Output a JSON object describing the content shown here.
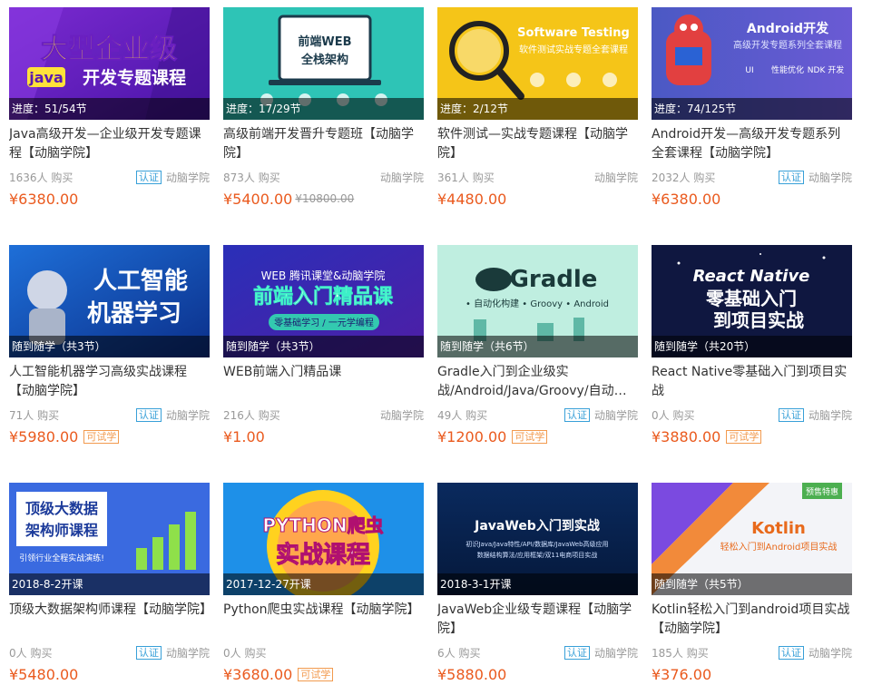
{
  "colors": {
    "price": "#ea5a1e",
    "cert": "#38a0d8",
    "trial": "#f29a4e"
  },
  "courses": [
    {
      "status": "进度：51/54节",
      "title": "Java高级开发—企业级开发专题课程【动脑学院】",
      "buyers": "1636人 购买",
      "cert": "认证",
      "org": "动脑学院",
      "price": "¥6380.00",
      "banner": {
        "line1": "大型企业级",
        "tag": "java",
        "line2": "开发专题课程"
      }
    },
    {
      "status": "进度：17/29节",
      "title": "高级前端开发晋升专题班【动脑学院】",
      "buyers": "873人 购买",
      "org": "动脑学院",
      "price": "¥5400.00",
      "old_price": "¥10800.00",
      "banner": {
        "line1": "前端WEB",
        "line2": "全栈架构"
      }
    },
    {
      "status": "进度：2/12节",
      "title": "软件测试—实战专题课程【动脑学院】",
      "buyers": "361人 购买",
      "org": "动脑学院",
      "price": "¥4480.00",
      "banner": {
        "line1": "Software Testing",
        "line2": "软件测试实战专题全套课程"
      }
    },
    {
      "status": "进度：74/125节",
      "title": "Android开发—高级开发专题系列全套课程【动脑学院】",
      "buyers": "2032人 购买",
      "cert": "认证",
      "org": "动脑学院",
      "price": "¥6380.00",
      "banner": {
        "line1": "Android开发",
        "line2": "高级开发专题系列全套课程",
        "tags": [
          "UI",
          "性能优化",
          "NDK 开发"
        ]
      }
    },
    {
      "status": "随到随学（共3节）",
      "title": "人工智能机器学习高级实战课程【动脑学院】",
      "buyers": "71人 购买",
      "cert": "认证",
      "org": "动脑学院",
      "price": "¥5980.00",
      "trial": "可试学",
      "banner": {
        "line1": "人工智能",
        "line2": "机器学习"
      }
    },
    {
      "status": "随到随学（共3节）",
      "title": "WEB前端入门精品课",
      "buyers": "216人 购买",
      "org": "动脑学院",
      "price": "¥1.00",
      "banner": {
        "line0": "WEB 腾讯课堂&动脑学院",
        "line1": "前端入门精品课",
        "line2": "零基础学习 / 一元学编程"
      }
    },
    {
      "status": "随到随学（共6节）",
      "title": "Gradle入门到企业级实战/Android/Java/Groovy/自动化构建",
      "buyers": "49人 购买",
      "cert": "认证",
      "org": "动脑学院",
      "price": "¥1200.00",
      "trial": "可试学",
      "banner": {
        "line1": "Gradle",
        "line2": "• 自动化构建   • Groovy   • Android"
      }
    },
    {
      "status": "随到随学（共20节）",
      "title": "React Native零基础入门到项目实战",
      "buyers": "0人 购买",
      "cert": "认证",
      "org": "动脑学院",
      "price": "¥3880.00",
      "trial": "可试学",
      "banner": {
        "line0": "React Native",
        "line1": "零基础入门",
        "line2": "到项目实战"
      }
    },
    {
      "status": "2018-8-2开课",
      "title": "顶级大数据架构师课程【动脑学院】",
      "buyers": "0人 购买",
      "cert": "认证",
      "org": "动脑学院",
      "price": "¥5480.00",
      "banner": {
        "line1": "顶级大数据",
        "line2": "架构师课程",
        "line3": "引领行业全程实战演练!"
      }
    },
    {
      "status": "2017-12-27开课",
      "title": "Python爬虫实战课程【动脑学院】",
      "buyers": "0人 购买",
      "org": "动脑学院",
      "price": "¥3680.00",
      "trial": "可试学",
      "banner": {
        "line1": "PYTHON爬虫",
        "line2": "实战课程"
      }
    },
    {
      "status": "2018-3-1开课",
      "title": "JavaWeb企业级专题课程【动脑学院】",
      "buyers": "6人 购买",
      "cert": "认证",
      "org": "动脑学院",
      "price": "¥5880.00",
      "banner": {
        "line1": "JavaWeb入门到实战",
        "line2": "初识Java/Java特性/API/数据库/JavaWeb高级应用",
        "line3": "数据结构算法/应用框架/双11电商项目实战"
      }
    },
    {
      "status": "随到随学（共5节）",
      "title": "Kotlin轻松入门到android项目实战【动脑学院】",
      "buyers": "185人 购买",
      "cert": "认证",
      "org": "动脑学院",
      "price": "¥376.00",
      "banner": {
        "badge": "预售特惠",
        "line1": "Kotlin",
        "line2": "轻松入门到Android项目实战"
      }
    }
  ]
}
